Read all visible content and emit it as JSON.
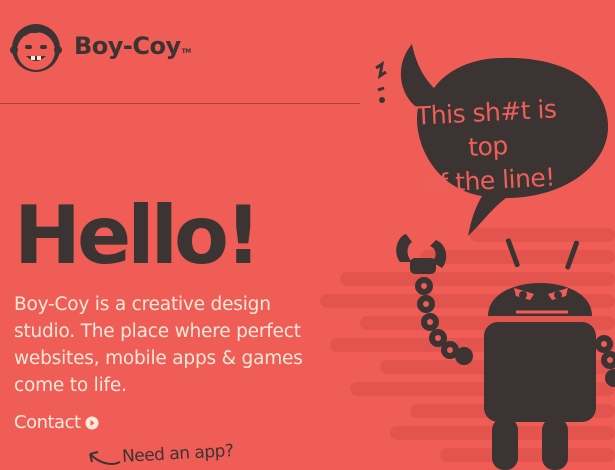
{
  "brand": {
    "name": "Boy-Coy",
    "trademark": "TM"
  },
  "bubble": {
    "line1": "This sh#t is top",
    "line2": "of the line!"
  },
  "hero": {
    "title": "Hello!",
    "intro": "Boy-Coy is a creative design studio. The place where perfect websites, mobile apps & games come to life."
  },
  "contact": {
    "label": "Contact"
  },
  "need_app": {
    "label": "Need an app?"
  },
  "colors": {
    "background": "#f05d57",
    "dark": "#3b3433",
    "light_text": "#fde9d9",
    "stripe": "#e4544f"
  }
}
